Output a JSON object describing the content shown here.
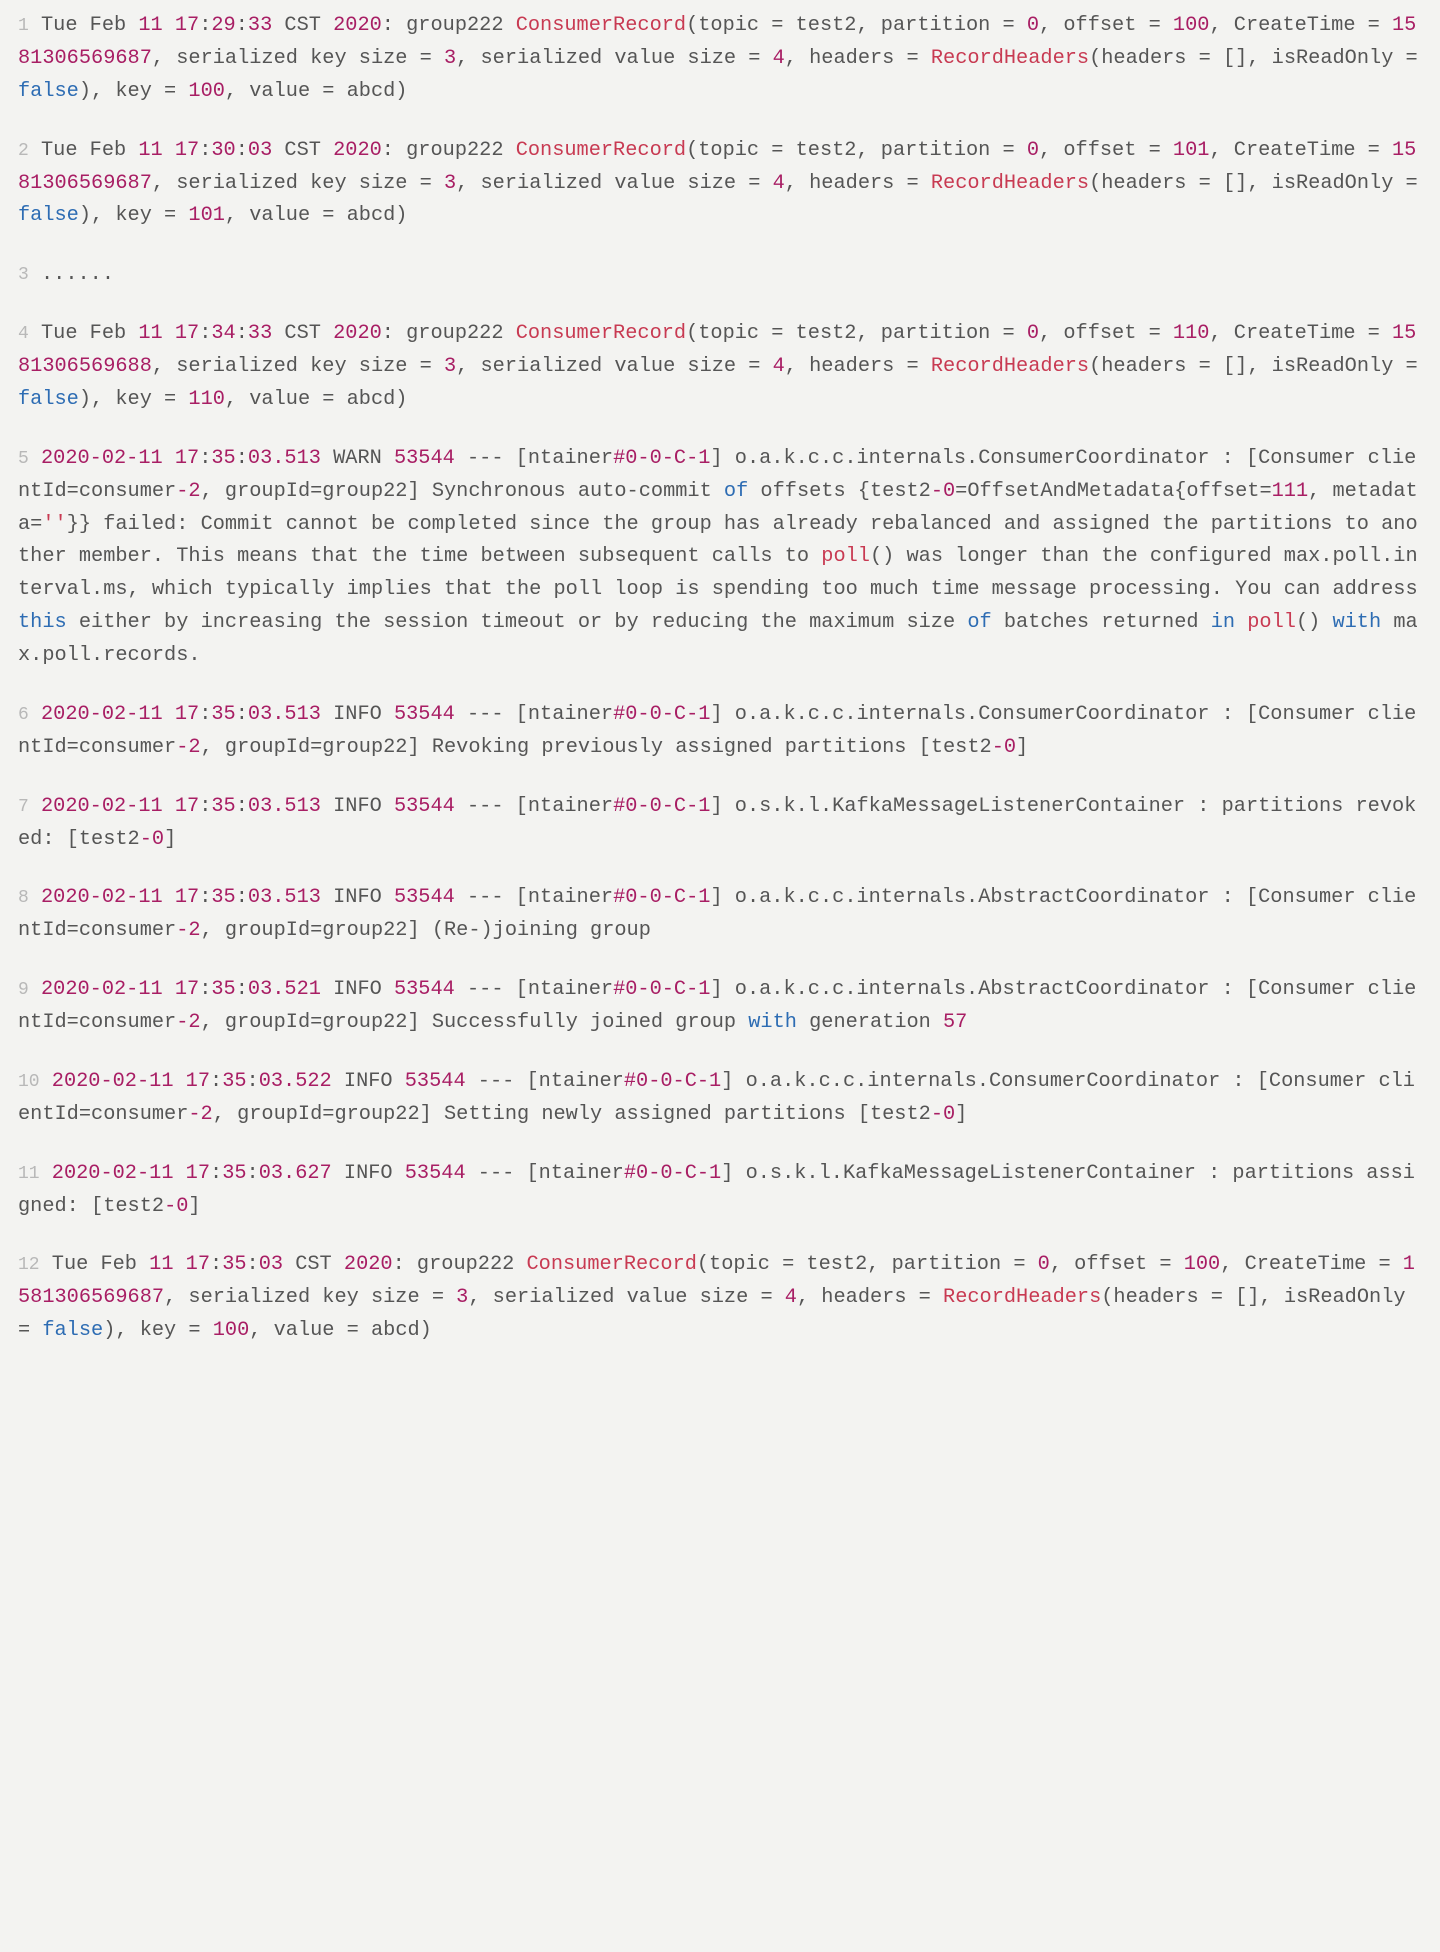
{
  "lines": [
    {
      "n": "1",
      "tokens": [
        {
          "c": "g1",
          "t": " Tue Feb "
        },
        {
          "c": "d1",
          "t": "11"
        },
        {
          "c": "g1",
          "t": " "
        },
        {
          "c": "d1",
          "t": "17"
        },
        {
          "c": "g1",
          "t": ":"
        },
        {
          "c": "d1",
          "t": "29"
        },
        {
          "c": "g1",
          "t": ":"
        },
        {
          "c": "d1",
          "t": "33"
        },
        {
          "c": "g1",
          "t": " CST "
        },
        {
          "c": "d1",
          "t": "2020"
        },
        {
          "c": "g1",
          "t": ": group222 "
        },
        {
          "c": "d2",
          "t": "ConsumerRecord"
        },
        {
          "c": "g1",
          "t": "(topic = test2, partition = "
        },
        {
          "c": "d1",
          "t": "0"
        },
        {
          "c": "g1",
          "t": ", offset = "
        },
        {
          "c": "d1",
          "t": "100"
        },
        {
          "c": "g1",
          "t": ", CreateTime = "
        },
        {
          "c": "d1",
          "t": "1581306569687"
        },
        {
          "c": "g1",
          "t": ", serialized key size = "
        },
        {
          "c": "d1",
          "t": "3"
        },
        {
          "c": "g1",
          "t": ", serialized value size = "
        },
        {
          "c": "d1",
          "t": "4"
        },
        {
          "c": "g1",
          "t": ", headers = "
        },
        {
          "c": "d2",
          "t": "RecordHeaders"
        },
        {
          "c": "g1",
          "t": "(headers = [], isReadOnly = "
        },
        {
          "c": "n1",
          "t": "false"
        },
        {
          "c": "g1",
          "t": "), key = "
        },
        {
          "c": "d1",
          "t": "100"
        },
        {
          "c": "g1",
          "t": ", value = abcd)"
        }
      ]
    },
    {
      "n": "2",
      "tokens": [
        {
          "c": "g1",
          "t": " Tue Feb "
        },
        {
          "c": "d1",
          "t": "11"
        },
        {
          "c": "g1",
          "t": " "
        },
        {
          "c": "d1",
          "t": "17"
        },
        {
          "c": "g1",
          "t": ":"
        },
        {
          "c": "d1",
          "t": "30"
        },
        {
          "c": "g1",
          "t": ":"
        },
        {
          "c": "d1",
          "t": "03"
        },
        {
          "c": "g1",
          "t": " CST "
        },
        {
          "c": "d1",
          "t": "2020"
        },
        {
          "c": "g1",
          "t": ": group222 "
        },
        {
          "c": "d2",
          "t": "ConsumerRecord"
        },
        {
          "c": "g1",
          "t": "(topic = test2, partition = "
        },
        {
          "c": "d1",
          "t": "0"
        },
        {
          "c": "g1",
          "t": ", offset = "
        },
        {
          "c": "d1",
          "t": "101"
        },
        {
          "c": "g1",
          "t": ", CreateTime = "
        },
        {
          "c": "d1",
          "t": "1581306569687"
        },
        {
          "c": "g1",
          "t": ", serialized key size = "
        },
        {
          "c": "d1",
          "t": "3"
        },
        {
          "c": "g1",
          "t": ", serialized value size = "
        },
        {
          "c": "d1",
          "t": "4"
        },
        {
          "c": "g1",
          "t": ", headers = "
        },
        {
          "c": "d2",
          "t": "RecordHeaders"
        },
        {
          "c": "g1",
          "t": "(headers = [], isReadOnly = "
        },
        {
          "c": "n1",
          "t": "false"
        },
        {
          "c": "g1",
          "t": "), key = "
        },
        {
          "c": "d1",
          "t": "101"
        },
        {
          "c": "g1",
          "t": ", value = abcd)"
        }
      ]
    },
    {
      "n": "3",
      "tokens": [
        {
          "c": "g1",
          "t": " ......"
        }
      ]
    },
    {
      "n": "4",
      "tokens": [
        {
          "c": "g1",
          "t": " Tue Feb "
        },
        {
          "c": "d1",
          "t": "11"
        },
        {
          "c": "g1",
          "t": " "
        },
        {
          "c": "d1",
          "t": "17"
        },
        {
          "c": "g1",
          "t": ":"
        },
        {
          "c": "d1",
          "t": "34"
        },
        {
          "c": "g1",
          "t": ":"
        },
        {
          "c": "d1",
          "t": "33"
        },
        {
          "c": "g1",
          "t": " CST "
        },
        {
          "c": "d1",
          "t": "2020"
        },
        {
          "c": "g1",
          "t": ": group222 "
        },
        {
          "c": "d2",
          "t": "ConsumerRecord"
        },
        {
          "c": "g1",
          "t": "(topic = test2, partition = "
        },
        {
          "c": "d1",
          "t": "0"
        },
        {
          "c": "g1",
          "t": ", offset = "
        },
        {
          "c": "d1",
          "t": "110"
        },
        {
          "c": "g1",
          "t": ", CreateTime = "
        },
        {
          "c": "d1",
          "t": "1581306569688"
        },
        {
          "c": "g1",
          "t": ", serialized key size = "
        },
        {
          "c": "d1",
          "t": "3"
        },
        {
          "c": "g1",
          "t": ", serialized value size = "
        },
        {
          "c": "d1",
          "t": "4"
        },
        {
          "c": "g1",
          "t": ", headers = "
        },
        {
          "c": "d2",
          "t": "RecordHeaders"
        },
        {
          "c": "g1",
          "t": "(headers = [], isReadOnly = "
        },
        {
          "c": "n1",
          "t": "false"
        },
        {
          "c": "g1",
          "t": "), key = "
        },
        {
          "c": "d1",
          "t": "110"
        },
        {
          "c": "g1",
          "t": ", value = abcd)"
        }
      ]
    },
    {
      "n": "5",
      "tokens": [
        {
          "c": "g1",
          "t": " "
        },
        {
          "c": "d1",
          "t": "2020-02-11 17"
        },
        {
          "c": "g1",
          "t": ":"
        },
        {
          "c": "d1",
          "t": "35"
        },
        {
          "c": "g1",
          "t": ":"
        },
        {
          "c": "d1",
          "t": "03.513"
        },
        {
          "c": "g1",
          "t": "  WARN "
        },
        {
          "c": "d1",
          "t": "53544"
        },
        {
          "c": "g1",
          "t": " --- [ntainer"
        },
        {
          "c": "d1",
          "t": "#0-0-C-1"
        },
        {
          "c": "g1",
          "t": "] o.a.k.c.c.internals.ConsumerCoordinator : [Consumer clientId=consumer"
        },
        {
          "c": "d1",
          "t": "-2"
        },
        {
          "c": "g1",
          "t": ", groupId=group22] Synchronous auto-commit "
        },
        {
          "c": "n1",
          "t": "of"
        },
        {
          "c": "g1",
          "t": " offsets {test2"
        },
        {
          "c": "d1",
          "t": "-0"
        },
        {
          "c": "g1",
          "t": "=OffsetAndMetadata{offset="
        },
        {
          "c": "d1",
          "t": "111"
        },
        {
          "c": "g1",
          "t": ", metadata="
        },
        {
          "c": "d2",
          "t": "''"
        },
        {
          "c": "g1",
          "t": "}} failed: Commit cannot be completed since the group has already rebalanced and assigned the partitions to another member. This means that the time between subsequent calls to "
        },
        {
          "c": "d2",
          "t": "poll"
        },
        {
          "c": "g1",
          "t": "() was longer than the configured max.poll.interval.ms, which typically implies that the poll loop is spending too much time message processing. You can address "
        },
        {
          "c": "n1",
          "t": "this"
        },
        {
          "c": "g1",
          "t": " either by increasing the session timeout or by reducing the maximum size "
        },
        {
          "c": "n1",
          "t": "of"
        },
        {
          "c": "g1",
          "t": " batches returned "
        },
        {
          "c": "n1",
          "t": "in"
        },
        {
          "c": "g1",
          "t": " "
        },
        {
          "c": "d2",
          "t": "poll"
        },
        {
          "c": "g1",
          "t": "() "
        },
        {
          "c": "n1",
          "t": "with"
        },
        {
          "c": "g1",
          "t": " max.poll.records."
        }
      ]
    },
    {
      "n": "6",
      "tokens": [
        {
          "c": "g1",
          "t": " "
        },
        {
          "c": "d1",
          "t": "2020-02-11 17"
        },
        {
          "c": "g1",
          "t": ":"
        },
        {
          "c": "d1",
          "t": "35"
        },
        {
          "c": "g1",
          "t": ":"
        },
        {
          "c": "d1",
          "t": "03.513"
        },
        {
          "c": "g1",
          "t": "  INFO "
        },
        {
          "c": "d1",
          "t": "53544"
        },
        {
          "c": "g1",
          "t": " --- [ntainer"
        },
        {
          "c": "d1",
          "t": "#0-0-C-1"
        },
        {
          "c": "g1",
          "t": "] o.a.k.c.c.internals.ConsumerCoordinator : [Consumer clientId=consumer"
        },
        {
          "c": "d1",
          "t": "-2"
        },
        {
          "c": "g1",
          "t": ", groupId=group22] Revoking previously assigned partitions [test2"
        },
        {
          "c": "d1",
          "t": "-0"
        },
        {
          "c": "g1",
          "t": "]"
        }
      ]
    },
    {
      "n": "7",
      "tokens": [
        {
          "c": "g1",
          "t": " "
        },
        {
          "c": "d1",
          "t": "2020-02-11 17"
        },
        {
          "c": "g1",
          "t": ":"
        },
        {
          "c": "d1",
          "t": "35"
        },
        {
          "c": "g1",
          "t": ":"
        },
        {
          "c": "d1",
          "t": "03.513"
        },
        {
          "c": "g1",
          "t": "  INFO "
        },
        {
          "c": "d1",
          "t": "53544"
        },
        {
          "c": "g1",
          "t": " --- [ntainer"
        },
        {
          "c": "d1",
          "t": "#0-0-C-1"
        },
        {
          "c": "g1",
          "t": "] o.s.k.l.KafkaMessageListenerContainer : partitions revoked: [test2"
        },
        {
          "c": "d1",
          "t": "-0"
        },
        {
          "c": "g1",
          "t": "]"
        }
      ]
    },
    {
      "n": "8",
      "tokens": [
        {
          "c": "g1",
          "t": " "
        },
        {
          "c": "d1",
          "t": "2020-02-11 17"
        },
        {
          "c": "g1",
          "t": ":"
        },
        {
          "c": "d1",
          "t": "35"
        },
        {
          "c": "g1",
          "t": ":"
        },
        {
          "c": "d1",
          "t": "03.513"
        },
        {
          "c": "g1",
          "t": "  INFO "
        },
        {
          "c": "d1",
          "t": "53544"
        },
        {
          "c": "g1",
          "t": " --- [ntainer"
        },
        {
          "c": "d1",
          "t": "#0-0-C-1"
        },
        {
          "c": "g1",
          "t": "] o.a.k.c.c.internals.AbstractCoordinator : [Consumer clientId=consumer"
        },
        {
          "c": "d1",
          "t": "-2"
        },
        {
          "c": "g1",
          "t": ", groupId=group22] (Re-)joining group"
        }
      ]
    },
    {
      "n": "9",
      "tokens": [
        {
          "c": "g1",
          "t": " "
        },
        {
          "c": "d1",
          "t": "2020-02-11 17"
        },
        {
          "c": "g1",
          "t": ":"
        },
        {
          "c": "d1",
          "t": "35"
        },
        {
          "c": "g1",
          "t": ":"
        },
        {
          "c": "d1",
          "t": "03.521"
        },
        {
          "c": "g1",
          "t": "  INFO "
        },
        {
          "c": "d1",
          "t": "53544"
        },
        {
          "c": "g1",
          "t": " --- [ntainer"
        },
        {
          "c": "d1",
          "t": "#0-0-C-1"
        },
        {
          "c": "g1",
          "t": "] o.a.k.c.c.internals.AbstractCoordinator : [Consumer clientId=consumer"
        },
        {
          "c": "d1",
          "t": "-2"
        },
        {
          "c": "g1",
          "t": ", groupId=group22] Successfully joined group "
        },
        {
          "c": "n1",
          "t": "with"
        },
        {
          "c": "g1",
          "t": " generation "
        },
        {
          "c": "d1",
          "t": "57"
        }
      ]
    },
    {
      "n": "10",
      "tokens": [
        {
          "c": "g1",
          "t": " "
        },
        {
          "c": "d1",
          "t": "2020-02-11 17"
        },
        {
          "c": "g1",
          "t": ":"
        },
        {
          "c": "d1",
          "t": "35"
        },
        {
          "c": "g1",
          "t": ":"
        },
        {
          "c": "d1",
          "t": "03.522"
        },
        {
          "c": "g1",
          "t": "  INFO "
        },
        {
          "c": "d1",
          "t": "53544"
        },
        {
          "c": "g1",
          "t": " --- [ntainer"
        },
        {
          "c": "d1",
          "t": "#0-0-C-1"
        },
        {
          "c": "g1",
          "t": "] o.a.k.c.c.internals.ConsumerCoordinator : [Consumer clientId=consumer"
        },
        {
          "c": "d1",
          "t": "-2"
        },
        {
          "c": "g1",
          "t": ", groupId=group22] Setting newly assigned partitions [test2"
        },
        {
          "c": "d1",
          "t": "-0"
        },
        {
          "c": "g1",
          "t": "]"
        }
      ]
    },
    {
      "n": "11",
      "tokens": [
        {
          "c": "g1",
          "t": " "
        },
        {
          "c": "d1",
          "t": "2020-02-11 17"
        },
        {
          "c": "g1",
          "t": ":"
        },
        {
          "c": "d1",
          "t": "35"
        },
        {
          "c": "g1",
          "t": ":"
        },
        {
          "c": "d1",
          "t": "03.627"
        },
        {
          "c": "g1",
          "t": "  INFO "
        },
        {
          "c": "d1",
          "t": "53544"
        },
        {
          "c": "g1",
          "t": " --- [ntainer"
        },
        {
          "c": "d1",
          "t": "#0-0-C-1"
        },
        {
          "c": "g1",
          "t": "] o.s.k.l.KafkaMessageListenerContainer : partitions assigned: [test2"
        },
        {
          "c": "d1",
          "t": "-0"
        },
        {
          "c": "g1",
          "t": "]"
        }
      ]
    },
    {
      "n": "12",
      "tokens": [
        {
          "c": "g1",
          "t": " Tue Feb "
        },
        {
          "c": "d1",
          "t": "11"
        },
        {
          "c": "g1",
          "t": " "
        },
        {
          "c": "d1",
          "t": "17"
        },
        {
          "c": "g1",
          "t": ":"
        },
        {
          "c": "d1",
          "t": "35"
        },
        {
          "c": "g1",
          "t": ":"
        },
        {
          "c": "d1",
          "t": "03"
        },
        {
          "c": "g1",
          "t": " CST "
        },
        {
          "c": "d1",
          "t": "2020"
        },
        {
          "c": "g1",
          "t": ": group222 "
        },
        {
          "c": "d2",
          "t": "ConsumerRecord"
        },
        {
          "c": "g1",
          "t": "(topic = test2, partition = "
        },
        {
          "c": "d1",
          "t": "0"
        },
        {
          "c": "g1",
          "t": ", offset = "
        },
        {
          "c": "d1",
          "t": "100"
        },
        {
          "c": "g1",
          "t": ", CreateTime = "
        },
        {
          "c": "d1",
          "t": "1581306569687"
        },
        {
          "c": "g1",
          "t": ", serialized key size = "
        },
        {
          "c": "d1",
          "t": "3"
        },
        {
          "c": "g1",
          "t": ", serialized value size = "
        },
        {
          "c": "d1",
          "t": "4"
        },
        {
          "c": "g1",
          "t": ", headers = "
        },
        {
          "c": "d2",
          "t": "RecordHeaders"
        },
        {
          "c": "g1",
          "t": "(headers = [], isReadOnly = "
        },
        {
          "c": "n1",
          "t": "false"
        },
        {
          "c": "g1",
          "t": "), key = "
        },
        {
          "c": "d1",
          "t": "100"
        },
        {
          "c": "g1",
          "t": ", value = abcd)"
        }
      ]
    }
  ]
}
